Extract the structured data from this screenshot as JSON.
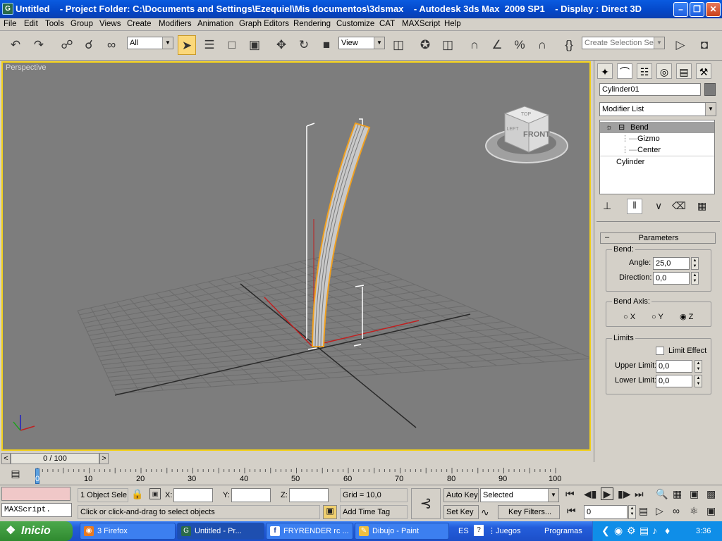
{
  "titlebar": {
    "text": "Untitled    - Project Folder: C:\\Documents and Settings\\Ezequiel\\Mis documentos\\3dsmax    - Autodesk 3ds Max  2009 SP1    - Display : Direct 3D"
  },
  "menu": [
    "File",
    "Edit",
    "Tools",
    "Group",
    "Views",
    "Create",
    "Modifiers",
    "Animation",
    "Graph Editors",
    "Rendering",
    "Customize",
    "CAT",
    "MAXScript",
    "Help"
  ],
  "toolbar": {
    "filter": "All",
    "reference_coord": "View",
    "selection_set_placeholder": "Create Selection Set"
  },
  "viewport": {
    "label": "Perspective",
    "viewcube_label": "FRONT",
    "viewcube_top": "TOP",
    "viewcube_left": "LEFT"
  },
  "command_panel": {
    "object_name": "Cylinder01",
    "modifier_list": "Modifier List",
    "stack": {
      "bend": "Bend",
      "gizmo": "Gizmo",
      "center": "Center",
      "cylinder": "Cylinder"
    },
    "rollout_title": "Parameters",
    "bend": {
      "group": "Bend:",
      "angle_label": "Angle:",
      "angle": "25,0",
      "direction_label": "Direction:",
      "direction": "0,0"
    },
    "bend_axis": {
      "group": "Bend Axis:",
      "x": "X",
      "y": "Y",
      "z": "Z"
    },
    "limits": {
      "group": "Limits",
      "limit_effect": "Limit Effect",
      "upper_label": "Upper Limit:",
      "upper": "0,0",
      "lower_label": "Lower Limit:",
      "lower": "0,0"
    }
  },
  "timeslider": {
    "label": "0 / 100"
  },
  "ruler": {
    "ticks": [
      "0",
      "10",
      "20",
      "30",
      "40",
      "50",
      "60",
      "70",
      "80",
      "90",
      "100"
    ]
  },
  "status": {
    "maxscript": "MAXScript.",
    "selection": "1 Object Sele",
    "x_label": "X:",
    "y_label": "Y:",
    "z_label": "Z:",
    "grid": "Grid = 10,0",
    "prompt": "Click or click-and-drag to select objects",
    "add_time_tag": "Add Time Tag",
    "auto_key": "Auto Key",
    "set_key": "Set Key",
    "selected": "Selected",
    "key_filters": "Key Filters...",
    "frame": "0"
  },
  "taskbar": {
    "start": "Inicio",
    "tasks": [
      "3 Firefox",
      "Untitled    - Pr...",
      "FRYRENDER rc ...",
      "Dibujo - Paint"
    ],
    "lang": "ES",
    "juegos": "Juegos",
    "programas": "Programas",
    "clock": "3:36"
  },
  "colors": {
    "viewport_border": "#f2d01a",
    "selection": "#f0a020",
    "titlebar": "#0a5be0"
  }
}
